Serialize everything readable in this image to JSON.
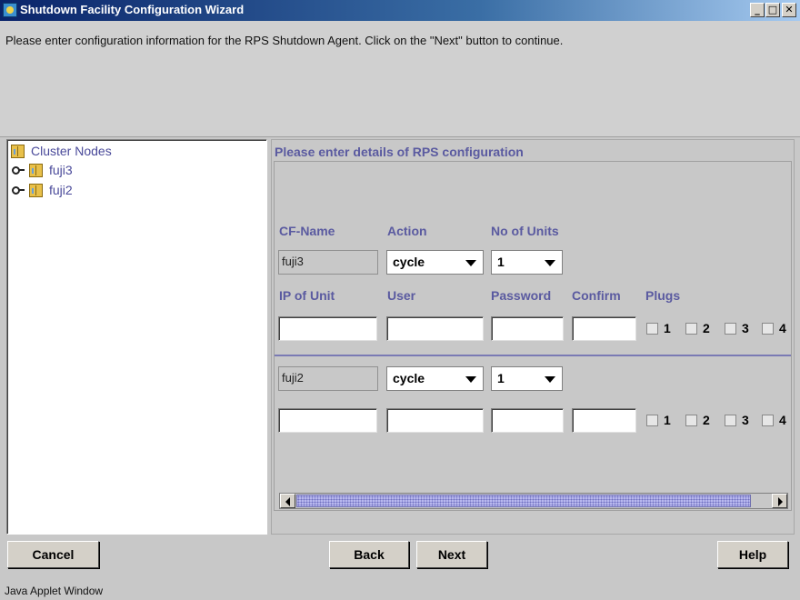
{
  "window": {
    "title": "Shutdown Facility Configuration Wizard",
    "minimize_glyph": "_",
    "maximize_glyph": "□",
    "close_glyph": "✕"
  },
  "instructions": "Please enter configuration information for the RPS Shutdown Agent. Click on the \"Next\" button to continue.",
  "tree": {
    "root": "Cluster Nodes",
    "nodes": [
      {
        "label": "fuji3"
      },
      {
        "label": "fuji2"
      }
    ]
  },
  "panel": {
    "heading": "Please enter details of RPS configuration",
    "headers": {
      "cf_name": "CF-Name",
      "action": "Action",
      "no_of_units": "No of Units",
      "ip_of_unit": "IP of Unit",
      "user": "User",
      "password": "Password",
      "confirm": "Confirm",
      "plugs": "Plugs"
    },
    "rows": [
      {
        "cf_name": "fuji3",
        "action": "cycle",
        "units": "1",
        "ip": "",
        "user": "",
        "password": "",
        "confirm": "",
        "plugs": [
          "1",
          "2",
          "3",
          "4"
        ]
      },
      {
        "cf_name": "fuji2",
        "action": "cycle",
        "units": "1",
        "ip": "",
        "user": "",
        "password": "",
        "confirm": "",
        "plugs": [
          "1",
          "2",
          "3",
          "4"
        ]
      }
    ]
  },
  "buttons": {
    "cancel": "Cancel",
    "back": "Back",
    "next": "Next",
    "help": "Help"
  },
  "status": "Java Applet Window",
  "icons": {
    "app": "java-cup-icon",
    "node": "server-icon",
    "expander": "expand-handle-icon"
  },
  "colors": {
    "label_blue": "#5a5aa0",
    "title_bar": "#0a246a",
    "scroll_thumb": "#b8b8ee"
  }
}
